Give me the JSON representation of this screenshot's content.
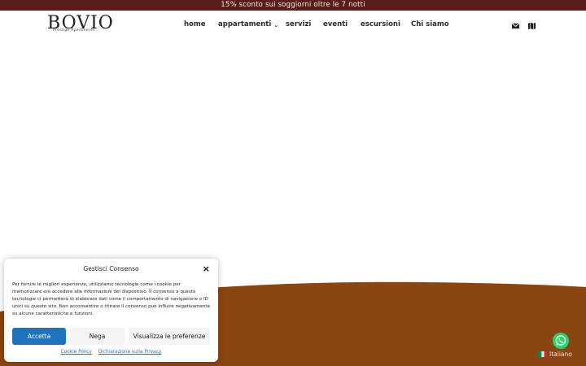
{
  "promo": {
    "text": "15% sconto sui soggiorni oltre le 7 notti"
  },
  "header": {
    "logo_word": "BOVIO",
    "logo_sub": "Prestige Apartments",
    "nav": [
      {
        "label": "home"
      },
      {
        "label": "appartamenti"
      },
      {
        "label": "servizi"
      },
      {
        "label": "eventi"
      },
      {
        "label": "escursioni"
      },
      {
        "label": "Chi siamo"
      }
    ],
    "icons": [
      "mail-icon",
      "map-icon"
    ]
  },
  "cookie": {
    "title": "Gestisci Consenso",
    "close": "×",
    "text": "Per fornire le migliori esperienze, utilizziamo tecnologie come i cookie per memorizzare e/o accedere alle informazioni del dispositivo. Il consenso a queste tecnologie ci permetterà di elaborare dati come il comportamento di navigazione o ID unici su questo sito. Non acconsentire o ritirare il consenso può influire negativamente su alcune caratteristiche e funzioni.",
    "accept": "Accetta",
    "deny": "Nega",
    "prefs": "Visualizza le preferenze",
    "link_policy": "Cookie Policy",
    "link_privacy": "Dichiarazione sulla Privacy"
  },
  "language": {
    "label": "Italiano"
  },
  "colors": {
    "brand_dark": "#5a1f1a",
    "brown": "#8b4513",
    "accept_blue": "#1e73be",
    "whatsapp": "#25d366"
  }
}
